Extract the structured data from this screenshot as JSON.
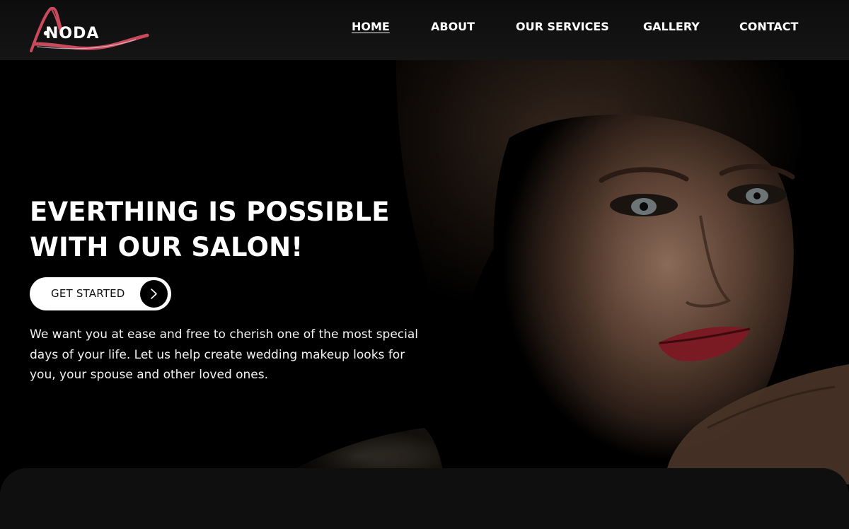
{
  "brand": {
    "logo_text": "NODA",
    "colors": {
      "accent": "#c94a5c",
      "background": "#000000",
      "header": "#111111",
      "panel": "#0f0f0f"
    }
  },
  "nav": {
    "items": [
      {
        "label": "HOME",
        "active": true
      },
      {
        "label": "ABOUT",
        "active": false
      },
      {
        "label": "OUR SERVICES",
        "active": false
      },
      {
        "label": "GALLERY",
        "active": false
      },
      {
        "label": "CONTACT",
        "active": false
      }
    ]
  },
  "hero": {
    "title_line1": "EVERTHING IS POSSIBLE",
    "title_line2": "WITH OUR SALON!",
    "cta_label": "GET STARTED",
    "cta_icon": "chevron-right-icon",
    "description": "We want you at ease and free to cherish one of the most special days of your life. Let us help create wedding makeup looks for you, your spouse and other loved ones."
  }
}
